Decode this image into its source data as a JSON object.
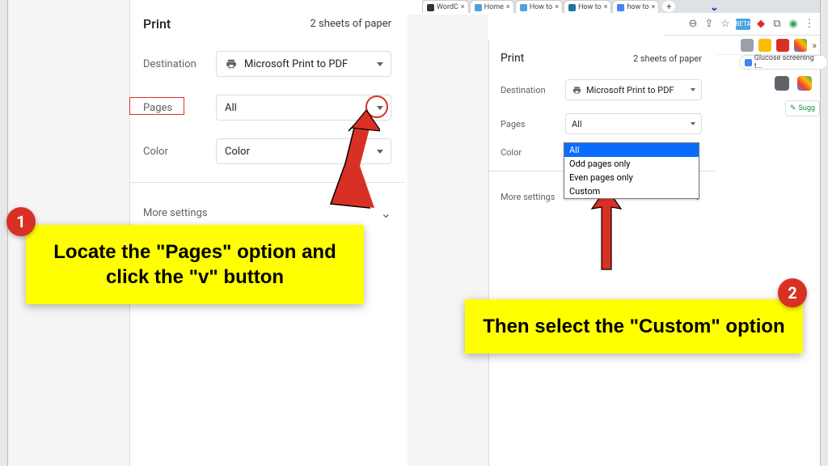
{
  "browser": {
    "tabs": [
      {
        "label": "WordC",
        "fav": "#333"
      },
      {
        "label": "Home",
        "fav": "#4aa3e0"
      },
      {
        "label": "How to",
        "fav": "#4aa3e0"
      },
      {
        "label": "How to",
        "fav": "#21759b"
      },
      {
        "label": "how to",
        "fav": "#4285f4"
      }
    ],
    "bookmark": "Glucose screening t...",
    "suggest_label": "Sugg"
  },
  "panelLeft": {
    "title": "Print",
    "sheets": "2 sheets of paper",
    "destination_label": "Destination",
    "destination_value": "Microsoft Print to PDF",
    "pages_label": "Pages",
    "pages_value": "All",
    "color_label": "Color",
    "color_value": "Color",
    "more": "More settings"
  },
  "panelRight": {
    "title": "Print",
    "sheets": "2 sheets of paper",
    "destination_label": "Destination",
    "destination_value": "Microsoft Print to PDF",
    "pages_label": "Pages",
    "pages_value": "All",
    "color_label": "Color",
    "more": "More settings",
    "dd": [
      "All",
      "Odd pages only",
      "Even pages only",
      "Custom"
    ]
  },
  "callouts": {
    "c1": "Locate the \"Pages\" option and click the \"v\" button",
    "c2": "Then select the \"Custom\" option",
    "b1": "1",
    "b2": "2"
  }
}
